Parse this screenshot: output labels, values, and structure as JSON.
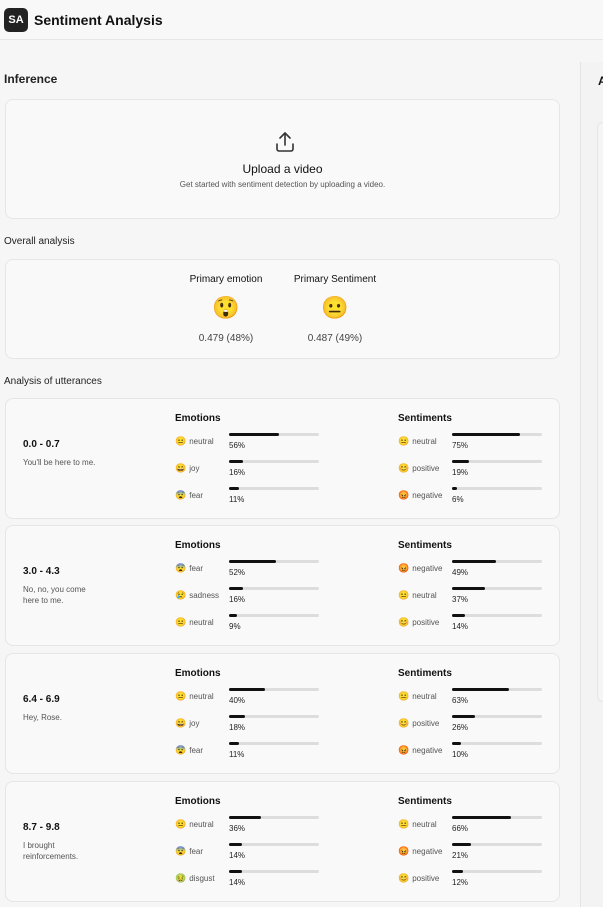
{
  "app": {
    "logo_text": "SA",
    "title": "Sentiment Analysis"
  },
  "right_panel": {
    "label": "A"
  },
  "inference": {
    "label": "Inference",
    "upload_title": "Upload a video",
    "upload_subtitle": "Get started with sentiment detection by uploading a video.",
    "upload_icon": "upload-icon"
  },
  "overall": {
    "label": "Overall analysis",
    "primary_emotion": {
      "title": "Primary emotion",
      "emoji": "😲",
      "score": "0.479 (48%)"
    },
    "primary_sentiment": {
      "title": "Primary Sentiment",
      "emoji": "😐",
      "score": "0.487 (49%)"
    }
  },
  "utterances_label": "Analysis of utterances",
  "utterances": [
    {
      "time": "0.0 - 0.7",
      "text": "You'll be here to me.",
      "emotions_title": "Emotions",
      "sentiments_title": "Sentiments",
      "emotions": [
        {
          "emoji": "😐",
          "label": "neutral",
          "value": 0.56,
          "pct": "56%"
        },
        {
          "emoji": "😄",
          "label": "joy",
          "value": 0.16,
          "pct": "16%"
        },
        {
          "emoji": "😨",
          "label": "fear",
          "value": 0.11,
          "pct": "11%"
        }
      ],
      "sentiments": [
        {
          "emoji": "😐",
          "label": "neutral",
          "value": 0.75,
          "pct": "75%"
        },
        {
          "emoji": "😊",
          "label": "positive",
          "value": 0.19,
          "pct": "19%"
        },
        {
          "emoji": "😡",
          "label": "negative",
          "value": 0.06,
          "pct": "6%"
        }
      ]
    },
    {
      "time": "3.0 - 4.3",
      "text": "No, no, you come here to me.",
      "emotions_title": "Emotions",
      "sentiments_title": "Sentiments",
      "emotions": [
        {
          "emoji": "😨",
          "label": "fear",
          "value": 0.52,
          "pct": "52%"
        },
        {
          "emoji": "😢",
          "label": "sadness",
          "value": 0.16,
          "pct": "16%"
        },
        {
          "emoji": "😐",
          "label": "neutral",
          "value": 0.09,
          "pct": "9%"
        }
      ],
      "sentiments": [
        {
          "emoji": "😡",
          "label": "negative",
          "value": 0.49,
          "pct": "49%"
        },
        {
          "emoji": "😐",
          "label": "neutral",
          "value": 0.37,
          "pct": "37%"
        },
        {
          "emoji": "😊",
          "label": "positive",
          "value": 0.14,
          "pct": "14%"
        }
      ]
    },
    {
      "time": "6.4 - 6.9",
      "text": "Hey, Rose.",
      "emotions_title": "Emotions",
      "sentiments_title": "Sentiments",
      "emotions": [
        {
          "emoji": "😐",
          "label": "neutral",
          "value": 0.4,
          "pct": "40%"
        },
        {
          "emoji": "😄",
          "label": "joy",
          "value": 0.18,
          "pct": "18%"
        },
        {
          "emoji": "😨",
          "label": "fear",
          "value": 0.11,
          "pct": "11%"
        }
      ],
      "sentiments": [
        {
          "emoji": "😐",
          "label": "neutral",
          "value": 0.63,
          "pct": "63%"
        },
        {
          "emoji": "😊",
          "label": "positive",
          "value": 0.26,
          "pct": "26%"
        },
        {
          "emoji": "😡",
          "label": "negative",
          "value": 0.1,
          "pct": "10%"
        }
      ]
    },
    {
      "time": "8.7 - 9.8",
      "text": "I brought reinforcements.",
      "emotions_title": "Emotions",
      "sentiments_title": "Sentiments",
      "emotions": [
        {
          "emoji": "😐",
          "label": "neutral",
          "value": 0.36,
          "pct": "36%"
        },
        {
          "emoji": "😨",
          "label": "fear",
          "value": 0.14,
          "pct": "14%"
        },
        {
          "emoji": "🤢",
          "label": "disgust",
          "value": 0.14,
          "pct": "14%"
        }
      ],
      "sentiments": [
        {
          "emoji": "😐",
          "label": "neutral",
          "value": 0.66,
          "pct": "66%"
        },
        {
          "emoji": "😡",
          "label": "negative",
          "value": 0.21,
          "pct": "21%"
        },
        {
          "emoji": "😊",
          "label": "positive",
          "value": 0.12,
          "pct": "12%"
        }
      ]
    }
  ]
}
